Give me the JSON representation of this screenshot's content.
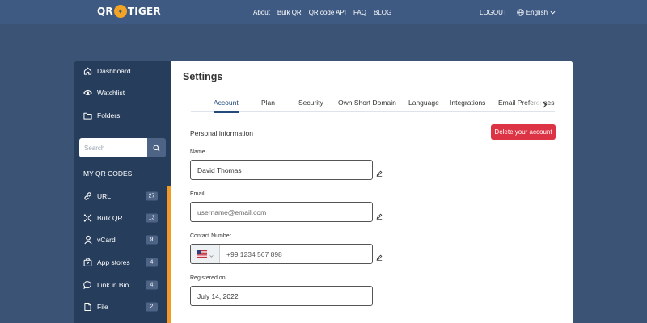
{
  "brand": {
    "logo_left": "QR",
    "logo_mark": "✦",
    "logo_right": "TIGER"
  },
  "nav": {
    "links": [
      "About",
      "Bulk QR",
      "QR code API",
      "FAQ",
      "BLOG"
    ],
    "logout": "LOGOUT",
    "language": "English"
  },
  "sidebar": {
    "main_items": [
      {
        "label": "Dashboard",
        "icon": "home-icon"
      },
      {
        "label": "Watchlist",
        "icon": "eye-icon"
      },
      {
        "label": "Folders",
        "icon": "folder-icon"
      }
    ],
    "search_placeholder": "Search",
    "section_title": "MY QR CODES",
    "qr_items": [
      {
        "label": "URL",
        "count": "27",
        "icon": "link-icon"
      },
      {
        "label": "Bulk QR",
        "count": "13",
        "icon": "bulk-qr-icon"
      },
      {
        "label": "vCard",
        "count": "9",
        "icon": "user-icon"
      },
      {
        "label": "App stores",
        "count": "4",
        "icon": "store-icon"
      },
      {
        "label": "Link in Bio",
        "count": "4",
        "icon": "chat-icon"
      },
      {
        "label": "File",
        "count": "2",
        "icon": "file-icon"
      }
    ],
    "accent_color": "#f39a25"
  },
  "main": {
    "title": "Settings",
    "tabs": [
      {
        "label": "Account",
        "active": true
      },
      {
        "label": "Plan"
      },
      {
        "label": "Security"
      },
      {
        "label": "Own Short Domain"
      },
      {
        "label": "Language"
      },
      {
        "label": "Integrations"
      },
      {
        "label": "Email Preferences"
      }
    ],
    "section_heading": "Personal information",
    "delete_button": "Delete your account",
    "delete_color": "#dc3444",
    "fields": {
      "name": {
        "label": "Name",
        "value": "David Thomas"
      },
      "email": {
        "label": "Email",
        "placeholder": "username@email.com"
      },
      "contact": {
        "label": "Contact Number",
        "placeholder": "+99 1234 567 898",
        "country": "US"
      },
      "registered": {
        "label": "Registered on",
        "value": "July 14, 2022"
      }
    }
  }
}
